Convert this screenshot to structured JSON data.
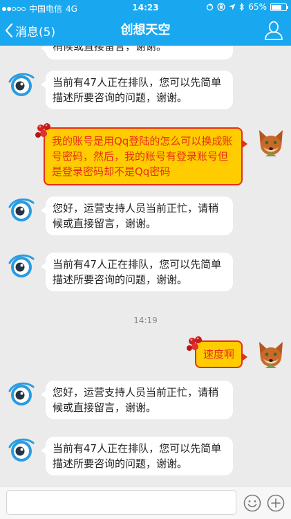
{
  "status_bar": {
    "carrier": "中国电信",
    "network": "4G",
    "time": "14:23",
    "battery": "65%"
  },
  "nav": {
    "back_label": "消息(5)",
    "title": "创想天空"
  },
  "messages": [
    {
      "side": "left",
      "text": "稍候或直接留言，谢谢。"
    },
    {
      "side": "left",
      "text": "当前有47人正在排队，您可以先简单描述所要咨询的问题，谢谢。"
    },
    {
      "side": "right",
      "text": "我的账号是用Qq登陆的怎么可以换成账号密码，然后，我的账号有登录账号但是登录密码却不是Qq密码"
    },
    {
      "side": "left",
      "text": "您好，运营支持人员当前正忙，请稍候或直接留言，谢谢。"
    },
    {
      "side": "left",
      "text": "当前有47人正在排队，您可以先简单描述所要咨询的问题，谢谢。"
    },
    {
      "side": "time",
      "text": "14:19"
    },
    {
      "side": "right",
      "text": "速度啊"
    },
    {
      "side": "left",
      "text": "您好，运营支持人员当前正忙，请稍候或直接留言，谢谢。"
    },
    {
      "side": "left",
      "text": "当前有47人正在排队，您可以先简单描述所要咨询的问题，谢谢。"
    }
  ],
  "input": {
    "value": "",
    "placeholder": ""
  },
  "colors": {
    "header": "#19a8f0",
    "chat_background": "#ebebeb",
    "user_bubble": "#ffcc00",
    "user_bubble_border": "#e62e16"
  },
  "icons": {
    "back": "chevron-left-icon",
    "profile": "person-outline-icon",
    "emoji": "smiley-icon",
    "more": "plus-circle-icon"
  }
}
